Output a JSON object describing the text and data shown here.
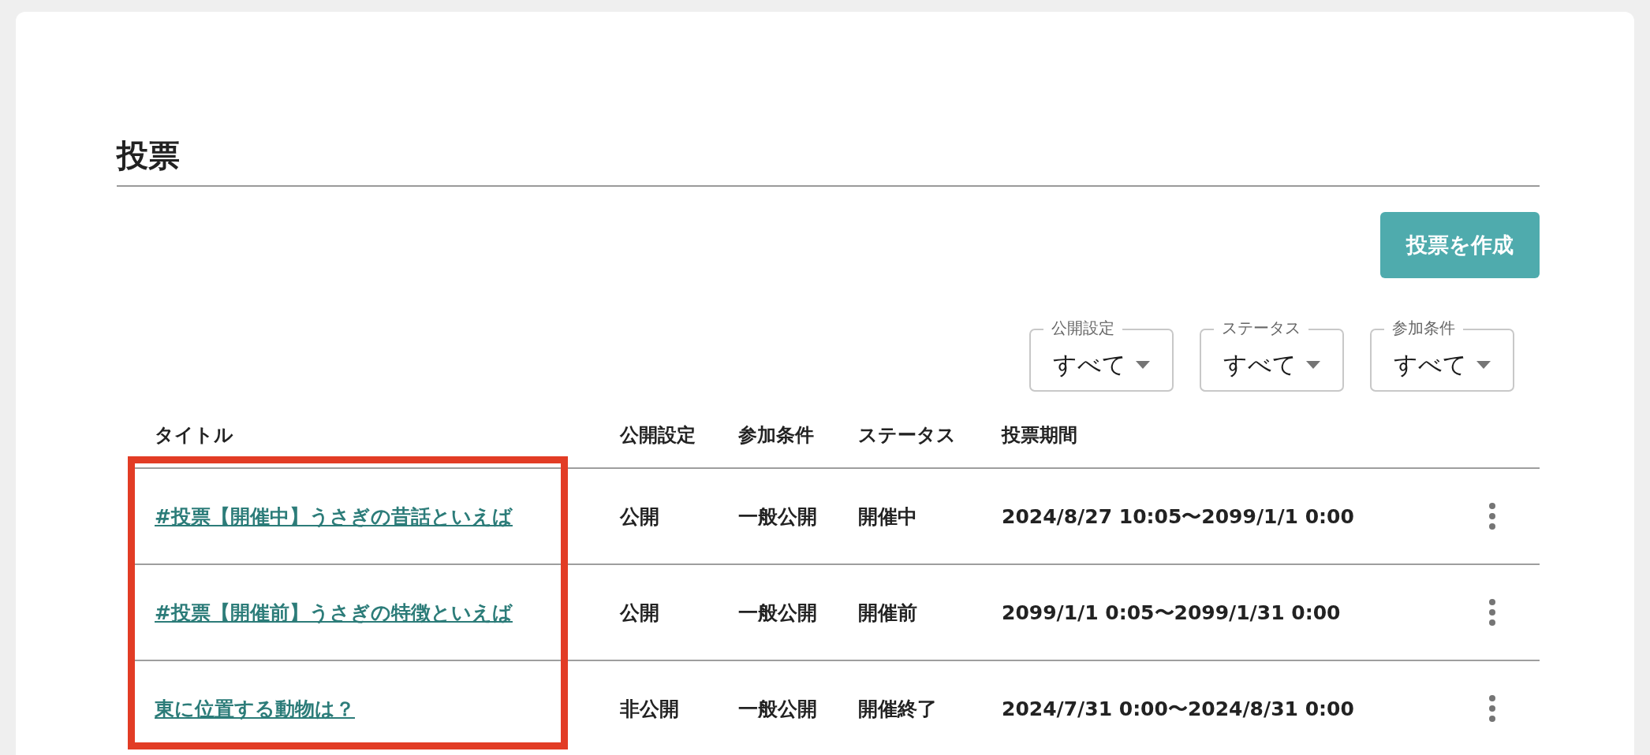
{
  "page": {
    "title": "投票"
  },
  "create_button": {
    "label": "投票を作成"
  },
  "filters": [
    {
      "label": "公開設定",
      "value": "すべて"
    },
    {
      "label": "ステータス",
      "value": "すべて"
    },
    {
      "label": "参加条件",
      "value": "すべて"
    }
  ],
  "table": {
    "columns": [
      "タイトル",
      "公開設定",
      "参加条件",
      "ステータス",
      "投票期間"
    ],
    "rows": [
      {
        "title": "#投票【開催中】うさぎの昔話といえば",
        "visibility": "公開",
        "condition": "一般公開",
        "status": "開催中",
        "period": "2024/8/27 10:05〜2099/1/1 0:00"
      },
      {
        "title": "#投票【開催前】うさぎの特徴といえば",
        "visibility": "公開",
        "condition": "一般公開",
        "status": "開催前",
        "period": "2099/1/1 0:05〜2099/1/31 0:00"
      },
      {
        "title": "東に位置する動物は？",
        "visibility": "非公開",
        "condition": "一般公開",
        "status": "開催終了",
        "period": "2024/7/31 0:00〜2024/8/31 0:00"
      }
    ]
  },
  "annotations": [
    {
      "kind": "highlight-box"
    }
  ]
}
